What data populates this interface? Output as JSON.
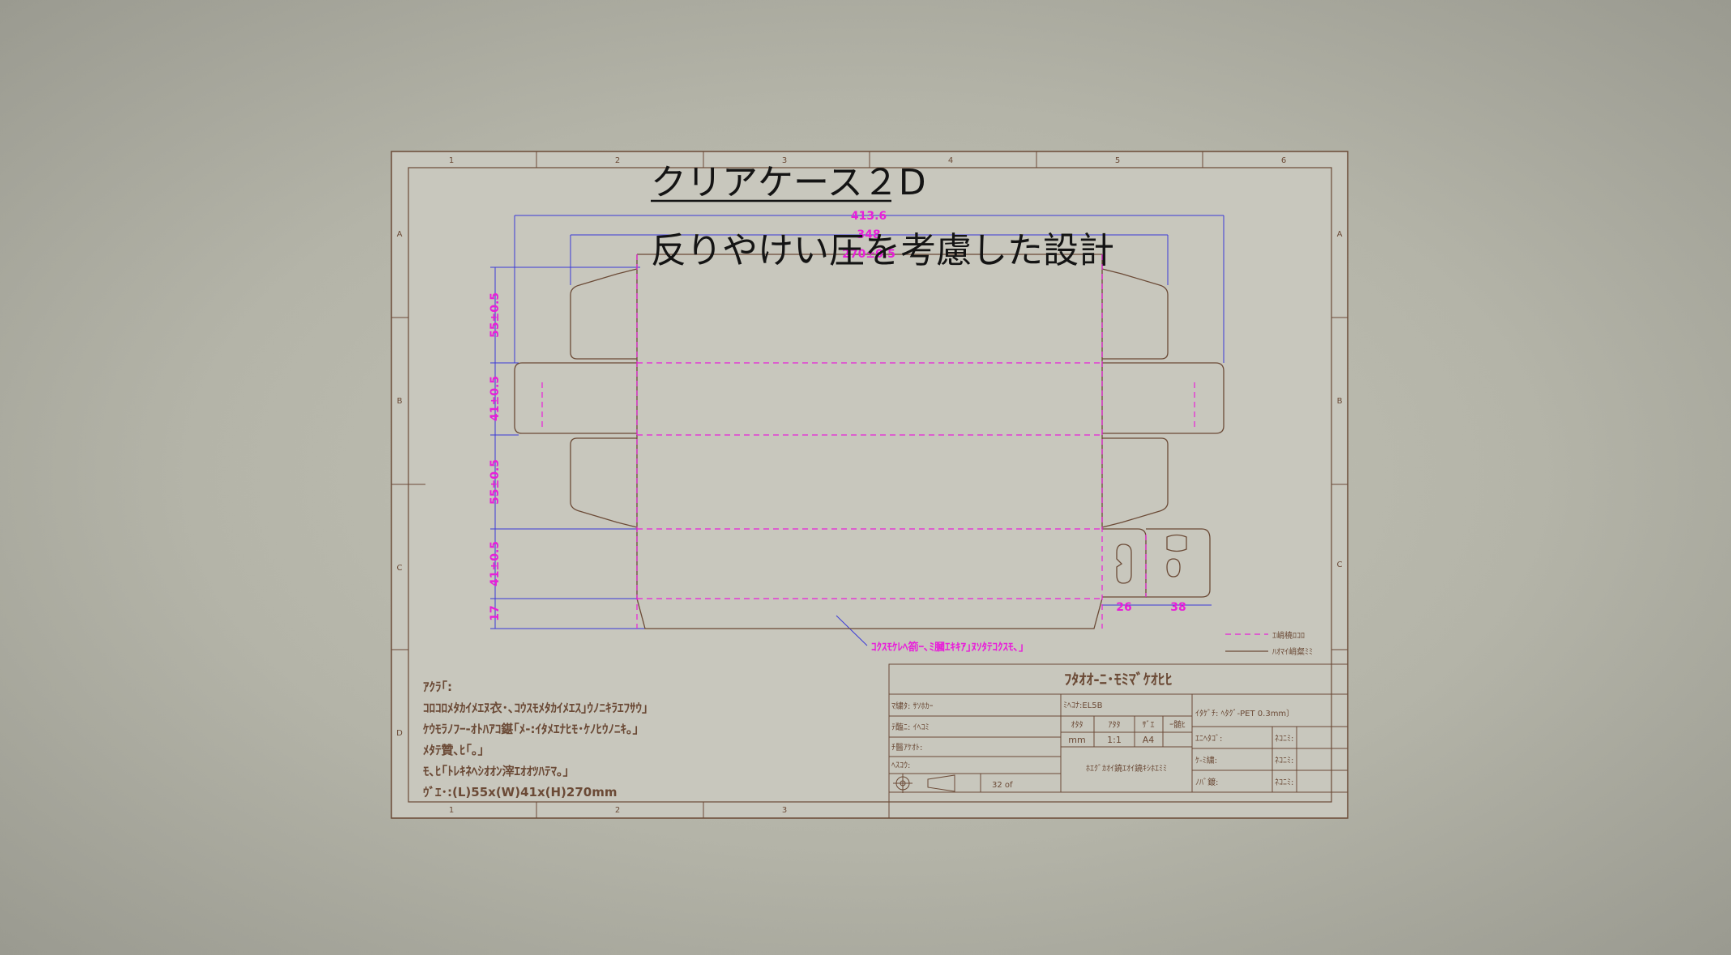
{
  "title": "クリアケース２D",
  "subtitle": "反りやけい圧を考慮した設計",
  "border": {
    "columns_top": [
      "1",
      "2",
      "3",
      "4",
      "5",
      "6"
    ],
    "columns_bottom": [
      "1",
      "2",
      "3"
    ],
    "rows": [
      "A",
      "B",
      "C",
      "D"
    ]
  },
  "dimensions": {
    "top_total": "413.6",
    "top_mid": "348",
    "top_inner": "270±0.5",
    "left": [
      "55±0.5",
      "41±0.5",
      "55±0.5",
      "41±0.5",
      "17"
    ],
    "bottom_tabs": [
      "26",
      "38"
    ]
  },
  "callout": "ｺｸｽﾓｹﾚﾍ箚ｰ､ﾐ膕ｴｷｷｱ｣ﾇｿﾀﾃｺｸｽﾓ､｣",
  "legend": {
    "dashed": "ｴ峭橈ﾛｺﾛ",
    "solid": "ﾊｵﾏｲ峭粲ﾐﾐ"
  },
  "notes": {
    "heading": "ｱｸﾗ｢:",
    "lines": [
      "ｺﾛｺﾛﾒﾀｶｲﾒｴﾇ衣･､ｺｳｽﾓﾒﾀｶｲﾒｴｽ｣ｳﾉﾆｷﾗｴﾌｻｳ｣",
      "ｹｳﾓﾗﾉﾌｰ-ｵﾄﾊｱｺ鍖｢ﾒ-:ｲﾀﾒｴﾅﾋﾓ･ｹﾉﾋｳﾉﾆｷ｡｣",
      "ﾒﾀﾃ贊､ﾋ｢｡｣",
      "ﾓ､ﾋ｢ﾄﾚｷﾈﾍｼｵｵﾝ滓ｴｵｵﾂﾊﾃﾏ｡｣",
      "ｳﾞｴ･:(L)55x(W)41x(H)270mm"
    ]
  },
  "title_block": {
    "name": "ﾌﾀｵｵ-ﾆ･ﾓﾐﾏﾞｹｵﾋﾋ",
    "drawn": "ﾏ繍ﾀ: ｻｿﾎｶｰ",
    "checked": "ﾃ醢ﾆ: ｲﾍｺﾐ",
    "approved": "ﾁ醫ｱｹｵﾄ:",
    "date": "ﾍｽｺｳ:",
    "scale_row": "32 of",
    "drawing_no": "ﾐﾍｺﾅ:EL5B",
    "headers": [
      "ｵﾀﾀ",
      "ｱﾀﾀ",
      "ｻﾞｴ",
      "ｰ髄ﾋ"
    ],
    "values": [
      "mm",
      "1:1",
      "A4",
      ""
    ],
    "company": "ﾎｴｸﾞｶｵｲ鐃ｴｵｲ鐃ｷｼﾎｴﾐﾐ",
    "material": "ｲﾀｹﾞﾁ: ﾍﾀｸﾞ-PET 0.3mm〕",
    "rev_labels": [
      "ｴﾆﾍﾀｺﾞ:",
      "ｹ-ﾐ繍:",
      "ﾉﾊﾞ鍍:"
    ],
    "rev_values": [
      "ﾈｺﾆﾐ:",
      "ﾈｺﾆﾐ:",
      "ﾈｺﾆﾐ:"
    ]
  },
  "colors": {
    "ink": "#6b4a36",
    "magenta": "#e81fd9",
    "dimension_blue": "#3a3ad8"
  }
}
